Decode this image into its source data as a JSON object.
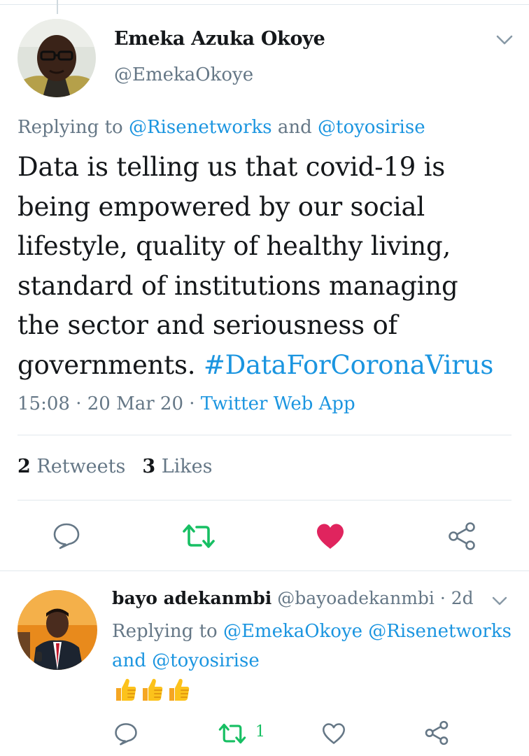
{
  "tweet": {
    "author_name": "Emeka Azuka Okoye",
    "author_handle": "@EmekaOkoye",
    "replying_prefix": "Replying to",
    "replying_to_1": "@Risenetworks",
    "replying_and": "and",
    "replying_to_2": "@toyosirise",
    "text_lines": [
      "Data is telling us that covid-19 is",
      "being empowered by our social",
      "lifestyle, quality of healthy living,",
      "standard of institutions managing",
      "the sector and seriousness of",
      "governments."
    ],
    "hashtag": "#DataForCoronaVirus",
    "time": "15:08",
    "date": "20 Mar 20",
    "separator": "·",
    "source": "Twitter Web App",
    "retweets_count": "2",
    "retweets_label": "Retweets",
    "likes_count": "3",
    "likes_label": "Likes",
    "liked": true
  },
  "reply": {
    "name": "bayo adekanmbi",
    "handle": "@bayoadekanmbi",
    "age": "2d",
    "separator": "·",
    "replying_prefix": "Replying to",
    "replying_to_1": "@EmekaOkoye",
    "replying_to_2": "@Risenetworks",
    "replying_and": "and",
    "replying_to_3": "@toyosirise",
    "emoji": [
      "thumbs-up",
      "thumbs-up",
      "thumbs-up"
    ],
    "retweet_count": "1"
  },
  "colors": {
    "link": "#1b95e0",
    "muted": "#657786",
    "retweet": "#17bf63",
    "like": "#e0245e",
    "divider": "#e1e8ed"
  },
  "icons": {
    "reply": "speech-bubble-icon",
    "retweet": "retweet-icon",
    "like": "heart-icon",
    "share": "share-icon",
    "more": "chevron-down-icon"
  }
}
